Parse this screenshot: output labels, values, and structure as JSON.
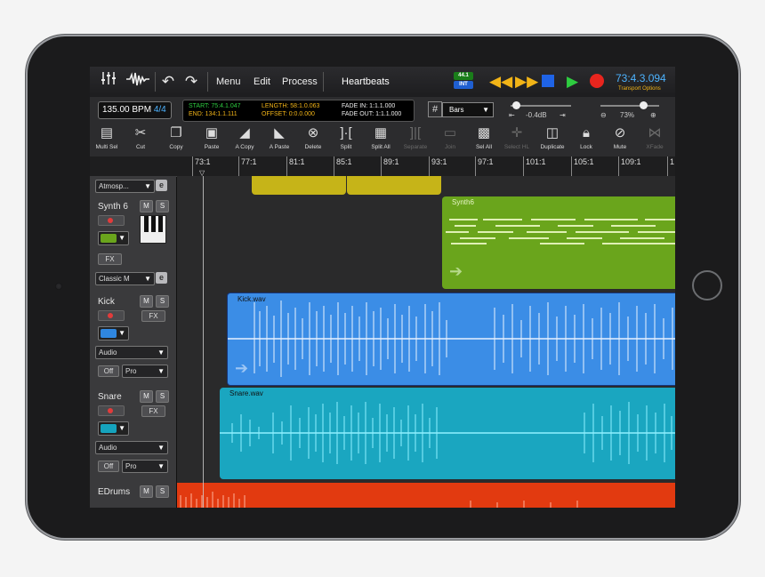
{
  "topbar": {
    "menu": [
      "Menu",
      "Edit",
      "Process"
    ],
    "song_title": "Heartbeats",
    "sample_rate": "44.1",
    "sync_mode": "INT",
    "timecode": "73:4.3.094",
    "transport_options": "Transport Options"
  },
  "infobar": {
    "bpm": "135.00 BPM",
    "time_sig": "4/4",
    "start": "START: 75:4.1.047",
    "end": "END: 134:1.1.111",
    "length": "LENGTH: 58:1.0.063",
    "offset": "OFFSET: 0:0.0.000",
    "fade_in": "FADE IN: 1:1.1.000",
    "fade_out": "FADE OUT: 1:1.1.000",
    "snap": "Bars",
    "volume": "-0.4dB",
    "zoom": "73%"
  },
  "toolbar": [
    {
      "label": "Multi Sel",
      "icon": "multi-select-icon"
    },
    {
      "label": "Cut",
      "icon": "scissors-icon"
    },
    {
      "label": "Copy",
      "icon": "copy-icon"
    },
    {
      "label": "Paste",
      "icon": "paste-icon"
    },
    {
      "label": "A Copy",
      "icon": "audio-copy-icon"
    },
    {
      "label": "A Paste",
      "icon": "audio-paste-icon"
    },
    {
      "label": "Delete",
      "icon": "delete-icon"
    },
    {
      "label": "Split",
      "icon": "split-icon"
    },
    {
      "label": "Split All",
      "icon": "split-all-icon"
    },
    {
      "label": "Separate",
      "icon": "separate-icon"
    },
    {
      "label": "Join",
      "icon": "join-icon"
    },
    {
      "label": "Sel All",
      "icon": "select-all-icon"
    },
    {
      "label": "Select HL",
      "icon": "select-highlight-icon"
    },
    {
      "label": "Duplicate",
      "icon": "duplicate-icon"
    },
    {
      "label": "Lock",
      "icon": "lock-icon"
    },
    {
      "label": "Mute",
      "icon": "mute-icon"
    },
    {
      "label": "XFade",
      "icon": "crossfade-icon"
    }
  ],
  "ruler": [
    "73:1",
    "77:1",
    "81:1",
    "85:1",
    "89:1",
    "93:1",
    "97:1",
    "101:1",
    "105:1",
    "109:1",
    "1"
  ],
  "tracks": {
    "atmos": {
      "name": "Atmosp...",
      "edit": "e"
    },
    "synth": {
      "name": "Synth 6",
      "m": "M",
      "s": "S",
      "fx": "FX",
      "preset": "Classic M",
      "edit": "e",
      "color": "#6aa51c",
      "clip": "Synth6"
    },
    "kick": {
      "name": "Kick",
      "m": "M",
      "s": "S",
      "fx": "FX",
      "input": "Audio",
      "monitor": "Off",
      "mode": "Pro",
      "color": "#2f87e0",
      "clip": "Kick.wav"
    },
    "snare": {
      "name": "Snare",
      "m": "M",
      "s": "S",
      "fx": "FX",
      "input": "Audio",
      "monitor": "Off",
      "mode": "Pro",
      "color": "#15a3bd",
      "clip": "Snare.wav"
    },
    "edrums": {
      "name": "EDrums",
      "m": "M",
      "s": "S",
      "color": "#e23a10"
    }
  },
  "colors": {
    "accent": "#4db3ff",
    "yellow": "#f2b417",
    "green": "#2ecc40",
    "red": "#e8251e",
    "synth": "#6aa51c",
    "kick": "#3b8de6",
    "snare": "#1aa6c0"
  }
}
